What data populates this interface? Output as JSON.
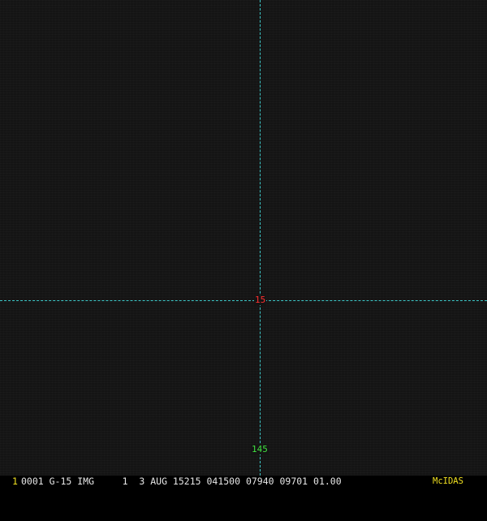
{
  "image": {
    "background": "#141414",
    "grid_color": "#3cc8c8"
  },
  "annotations": {
    "latitude_label": "15",
    "latitude_color": "#ff3030",
    "longitude_label": "145",
    "longitude_color": "#40e040"
  },
  "status_bar": {
    "frame_number": "1",
    "frame_color": "#f0e020",
    "text": "0001 G-15 IMG     1  3 AUG 15215 041500 07940 09701 01.00",
    "text_color": "#e6e6e6",
    "brand": "McIDAS",
    "brand_color": "#f0e020"
  }
}
